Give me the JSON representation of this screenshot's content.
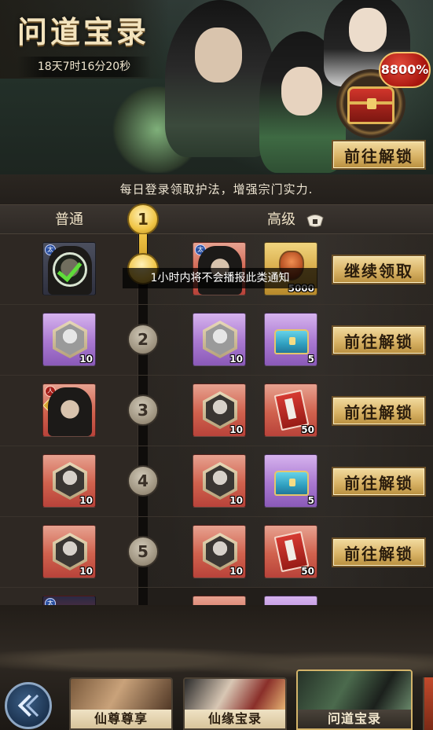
{
  "banner": {
    "title": "问道宝录",
    "timer": "18天7时16分20秒",
    "bonus_badge": "8800%",
    "unlock_button": "前往解锁"
  },
  "info_text": "每日登录领取护法，增强宗门实力.",
  "columns": {
    "normal": "普通",
    "advanced": "高级",
    "advanced_icon": "lock-icon"
  },
  "toast": "1小时内将不会播报此类通知",
  "rows": [
    {
      "level": "1",
      "normal_item": {
        "type": "character",
        "count": "",
        "claimed": true
      },
      "advanced_items": [
        {
          "type": "character",
          "count": ""
        },
        {
          "type": "gold-token",
          "count": "5000"
        }
      ],
      "button": "继续领取"
    },
    {
      "level": "2",
      "normal_item": {
        "type": "silver-portrait",
        "count": "10"
      },
      "advanced_items": [
        {
          "type": "silver-portrait",
          "count": "10"
        },
        {
          "type": "blue-chest",
          "count": "5"
        }
      ],
      "button": "前往解锁"
    },
    {
      "level": "3",
      "normal_item": {
        "type": "character",
        "count": ""
      },
      "advanced_items": [
        {
          "type": "red-portrait",
          "count": "10"
        },
        {
          "type": "red-book",
          "count": "50"
        }
      ],
      "button": "前往解锁"
    },
    {
      "level": "4",
      "normal_item": {
        "type": "red-portrait",
        "count": "10"
      },
      "advanced_items": [
        {
          "type": "red-portrait",
          "count": "10"
        },
        {
          "type": "blue-chest",
          "count": "5"
        }
      ],
      "button": "前往解锁"
    },
    {
      "level": "5",
      "normal_item": {
        "type": "red-portrait",
        "count": "10"
      },
      "advanced_items": [
        {
          "type": "red-portrait",
          "count": "10"
        },
        {
          "type": "red-book",
          "count": "50"
        }
      ],
      "button": "前往解锁"
    }
  ],
  "nav": {
    "back_icon": "back-chevron-icon",
    "tabs": [
      {
        "label": "仙尊尊享"
      },
      {
        "label": "仙缘宝录"
      },
      {
        "label": "问道宝录",
        "active": true
      }
    ]
  }
}
